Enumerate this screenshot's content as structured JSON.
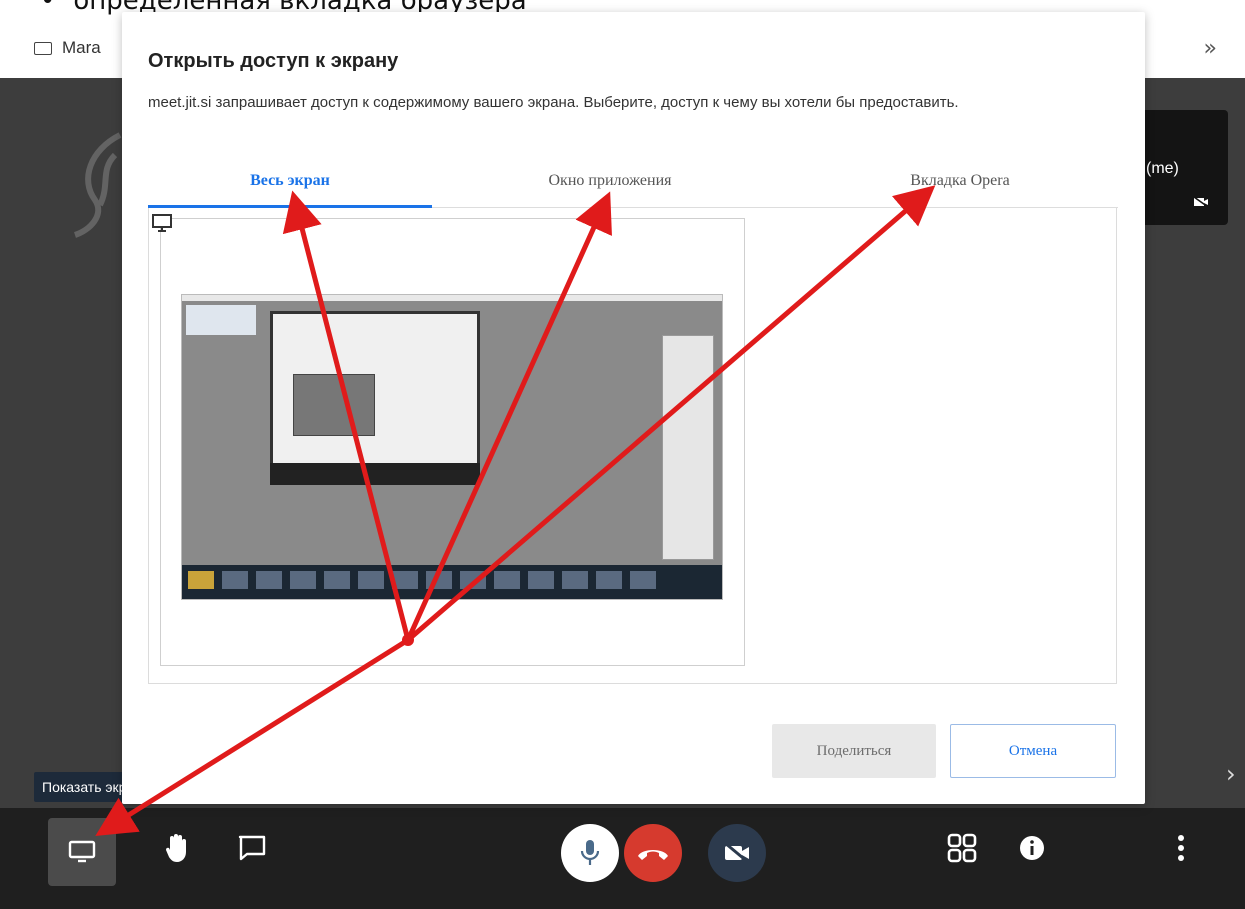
{
  "document": {
    "bullet": "•",
    "text": "определенная вкладка браузера"
  },
  "browser": {
    "bookmark_folder_label": "Mara",
    "bookmarks_more": "»"
  },
  "meeting": {
    "self_label": "(me)",
    "tooltip": "Показать экран",
    "next_arrow": "›"
  },
  "dialog": {
    "title": "Открыть доступ к экрану",
    "description": "meet.jit.si запрашивает доступ к содержимому вашего экрана. Выберите, доступ к чему вы хотели бы предоставить.",
    "tabs": [
      {
        "label": "Весь экран",
        "active": true
      },
      {
        "label": "Окно приложения",
        "active": false
      },
      {
        "label": "Вкладка Opera",
        "active": false
      }
    ],
    "share_label": "Поделиться",
    "cancel_label": "Отмена"
  },
  "toolbar": {
    "buttons": [
      "screen-share-icon",
      "raise-hand-icon",
      "chat-icon",
      "microphone-icon",
      "hang-up-icon",
      "camera-off-icon",
      "tile-view-icon",
      "info-icon",
      "more-vertical-icon"
    ]
  },
  "colors": {
    "accent": "#1a73e8",
    "hangup": "#d63a2e",
    "arrow": "#e01b1b"
  }
}
